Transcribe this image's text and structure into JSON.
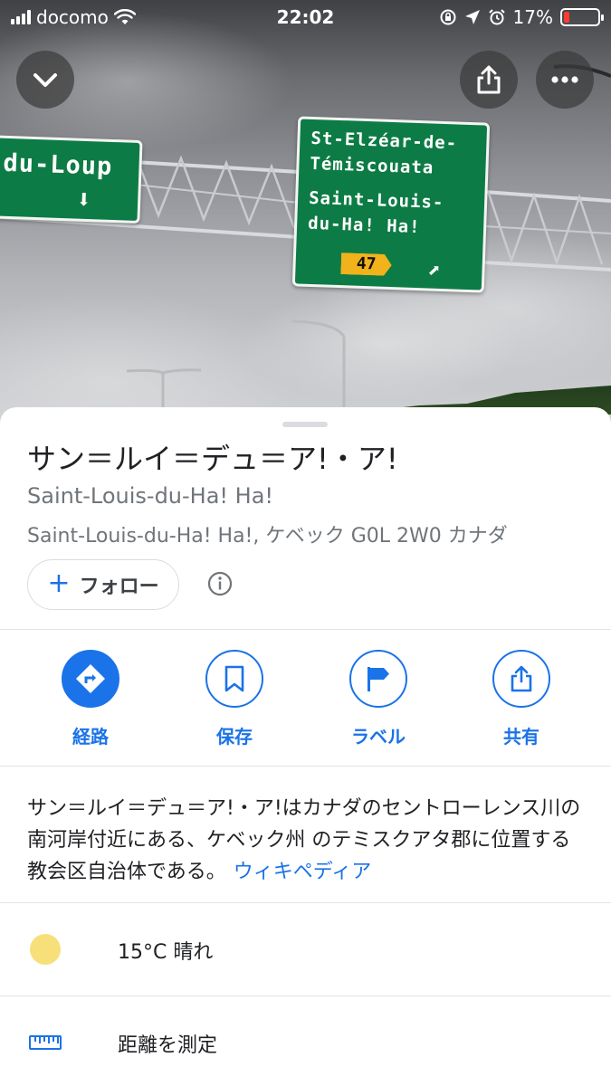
{
  "status_bar": {
    "carrier": "docomo",
    "time": "22:02",
    "battery": "17%",
    "battery_level": 0.17,
    "battery_color": "#ff3b30"
  },
  "hero": {
    "sign_left_text": "du-Loup",
    "sign_right_lines": [
      "St-Elzéar-de-",
      "Témiscouata",
      "Saint-Louis-",
      "du-Ha! Ha!"
    ],
    "route_number": "47"
  },
  "place": {
    "title": "サン＝ルイ＝デュ＝ア!・ア!",
    "subtitle": "Saint-Louis-du-Ha! Ha!",
    "address": "Saint-Louis-du-Ha! Ha!, ケベック G0L 2W0 カナダ"
  },
  "follow": {
    "label": "フォロー"
  },
  "actions": [
    {
      "label": "経路",
      "icon": "directions-icon"
    },
    {
      "label": "保存",
      "icon": "bookmark-icon"
    },
    {
      "label": "ラベル",
      "icon": "flag-icon"
    },
    {
      "label": "共有",
      "icon": "share-icon"
    }
  ],
  "description": {
    "text": "サン＝ルイ＝デュ＝ア!・ア!はカナダのセントローレンス川の南河岸付近にある、ケベック州 のテミスクアタ郡に位置する教会区自治体である。",
    "link": "ウィキペディア"
  },
  "weather": {
    "text": "15°C 晴れ",
    "icon": "sun-icon"
  },
  "measure": {
    "text": "距離を測定",
    "icon": "ruler-icon"
  },
  "colors": {
    "accent": "#1a73e8",
    "secondary_text": "#70757a",
    "sign_green": "#0d7b45"
  }
}
